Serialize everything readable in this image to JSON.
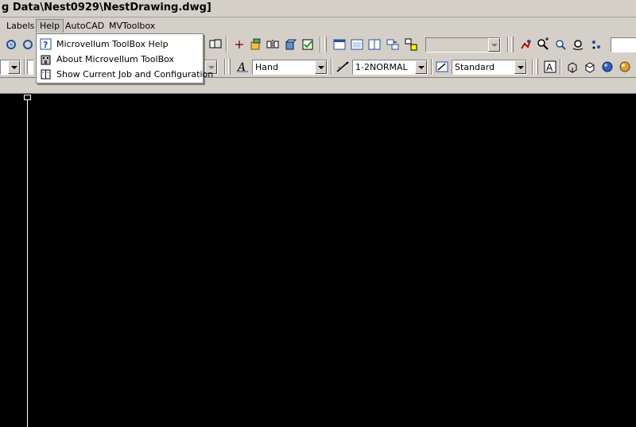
{
  "window": {
    "title": "g Data\\Nest0929\\NestDrawing.dwg]"
  },
  "menubar": {
    "items": [
      {
        "label": "Labels"
      },
      {
        "label": "Help"
      },
      {
        "label": "AutoCAD"
      },
      {
        "label": "MVToolbox"
      }
    ],
    "active": "Help"
  },
  "help_menu": {
    "items": [
      {
        "label": "Microvellum ToolBox Help",
        "icon": "help-question-icon"
      },
      {
        "label": "About Microvellum ToolBox",
        "icon": "building-icon"
      },
      {
        "label": "Show Current Job and Configuration",
        "icon": "book-icon"
      }
    ]
  },
  "toolbar2": {
    "text_style": "Hand",
    "dim_style": "1-2NORMAL",
    "table_style": "Standard"
  },
  "colors": {
    "background": "#d4d0c8",
    "drawing_area": "#000000",
    "accent": "#0a246a"
  }
}
